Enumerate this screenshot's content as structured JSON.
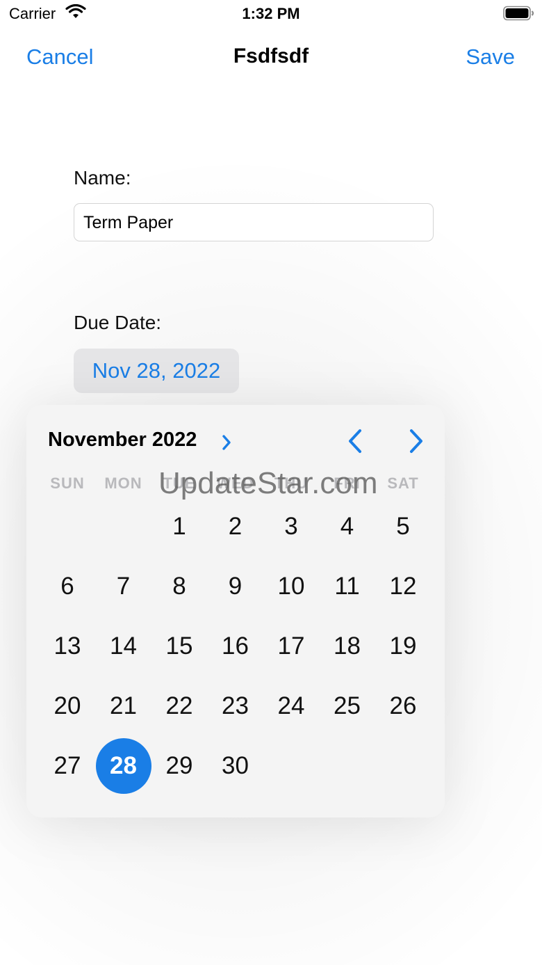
{
  "status_bar": {
    "carrier": "Carrier",
    "time": "1:32 PM"
  },
  "nav": {
    "cancel": "Cancel",
    "title": "Fsdfsdf",
    "save": "Save"
  },
  "form": {
    "name_label": "Name:",
    "name_value": "Term Paper",
    "due_label": "Due Date:",
    "due_value": "Nov 28, 2022"
  },
  "calendar": {
    "month_label": "November 2022",
    "weekdays": [
      "SUN",
      "MON",
      "TUE",
      "WED",
      "THU",
      "FRI",
      "SAT"
    ],
    "days": [
      "1",
      "2",
      "3",
      "4",
      "5",
      "6",
      "7",
      "8",
      "9",
      "10",
      "11",
      "12",
      "13",
      "14",
      "15",
      "16",
      "17",
      "18",
      "19",
      "20",
      "21",
      "22",
      "23",
      "24",
      "25",
      "26",
      "27",
      "28",
      "29",
      "30"
    ],
    "selected_day": "28",
    "first_weekday_index": 2
  },
  "watermark": "UpdateStar.com",
  "colors": {
    "accent": "#1a7ee6",
    "chip_bg": "#e5e5e7",
    "calendar_bg": "#f4f4f4"
  }
}
